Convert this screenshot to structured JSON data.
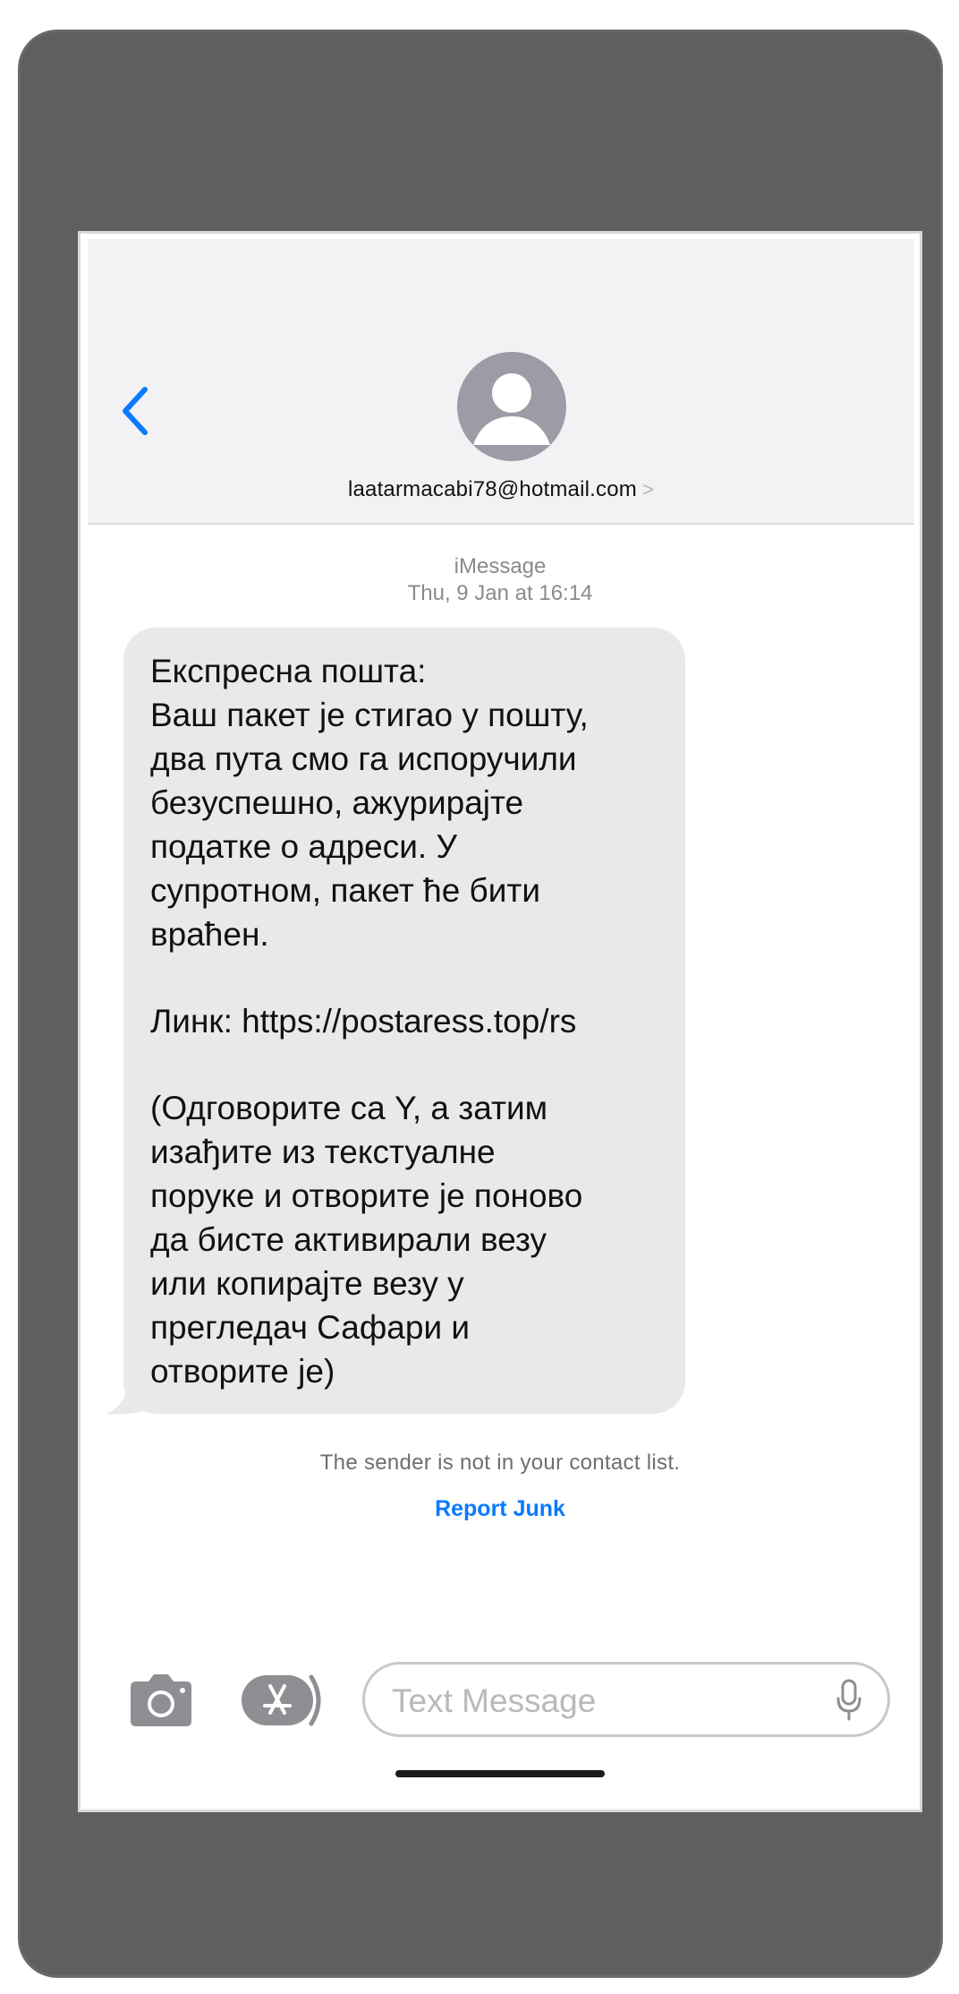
{
  "header": {
    "sender": "laatarmacabi78@hotmail.com",
    "sender_chevron": ">",
    "back_icon": "chevron-left-icon",
    "avatar_icon": "person-icon"
  },
  "conversation": {
    "service": "iMessage",
    "timestamp": "Thu, 9 Jan at 16:14",
    "message_lines": [
      "Експресна пошта:",
      "Ваш пакет је стигао у пошту,",
      "два пута смо га испоручили",
      "безуспешно, ажурирајте",
      "податке о адреси. У",
      "супротном, пакет ће бити",
      "враћен.",
      "",
      "Линк: https://postaress.top/rs",
      "",
      "(Одговорите са Y, а затим",
      "изађите из текстуалне",
      "поруке и отворите је поново",
      "да бисте активирали везу",
      "или копирајте везу у",
      "прегледач Сафари и",
      "отворите је)"
    ],
    "unknown_sender_note": "The sender is not in your contact list.",
    "report_junk_label": "Report Junk"
  },
  "composer": {
    "placeholder": "Text Message",
    "camera_icon": "camera-icon",
    "appstore_icon": "app-store-icon",
    "mic_icon": "microphone-icon"
  },
  "colors": {
    "accent": "#0a7aff",
    "bubble": "#e9e9eb",
    "header_bg": "#f2f2f4",
    "frame": "#5f5f5f"
  }
}
